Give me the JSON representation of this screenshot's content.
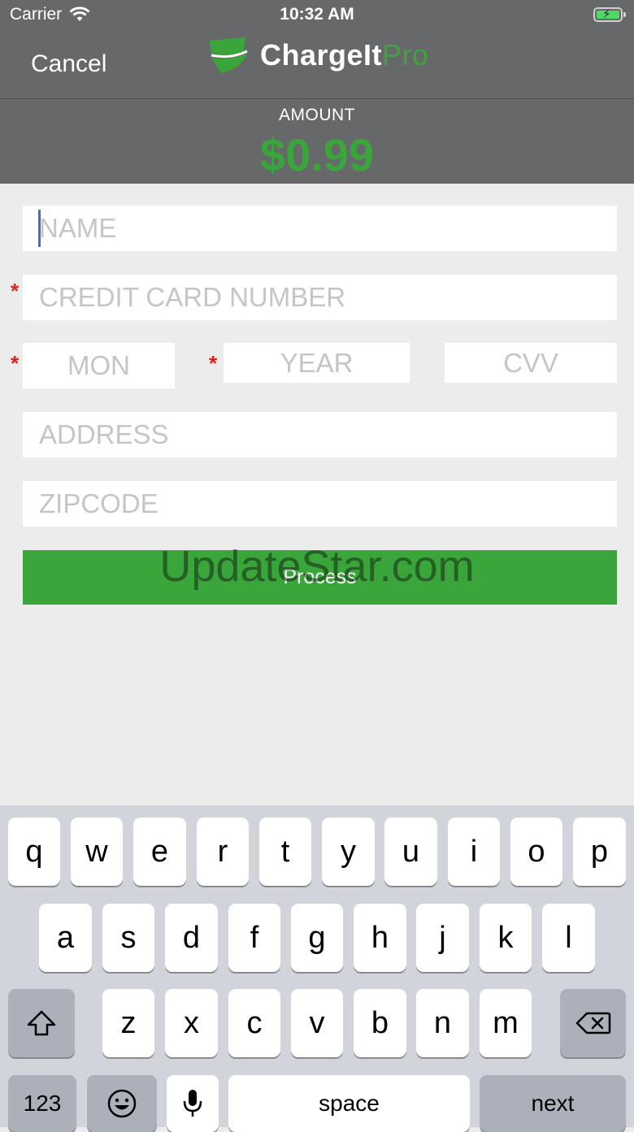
{
  "status_bar": {
    "carrier": "Carrier",
    "time": "10:32 AM"
  },
  "nav": {
    "cancel_label": "Cancel",
    "logo_main": "ChargeIt",
    "logo_accent": "Pro"
  },
  "amount": {
    "label": "AMOUNT",
    "value": "$0.99"
  },
  "form": {
    "name_placeholder": "NAME",
    "card_placeholder": "CREDIT CARD NUMBER",
    "month_placeholder": "MON",
    "year_placeholder": "YEAR",
    "cvv_placeholder": "CVV",
    "address_placeholder": "ADDRESS",
    "zip_placeholder": "ZIPCODE",
    "required_mark": "*",
    "process_label": "Process"
  },
  "watermark": "UpdateStar.com",
  "keyboard": {
    "row1": [
      "q",
      "w",
      "e",
      "r",
      "t",
      "y",
      "u",
      "i",
      "o",
      "p"
    ],
    "row2": [
      "a",
      "s",
      "d",
      "f",
      "g",
      "h",
      "j",
      "k",
      "l"
    ],
    "row3": [
      "z",
      "x",
      "c",
      "v",
      "b",
      "n",
      "m"
    ],
    "numbers_label": "123",
    "space_label": "space",
    "next_label": "next"
  },
  "colors": {
    "brand_green": "#3aa53a",
    "header_gray": "#67686a",
    "required_red": "#e02020"
  },
  "icons": [
    "wifi-icon",
    "battery-icon",
    "logo-icon",
    "shift-icon",
    "backspace-icon",
    "emoji-icon",
    "microphone-icon"
  ]
}
